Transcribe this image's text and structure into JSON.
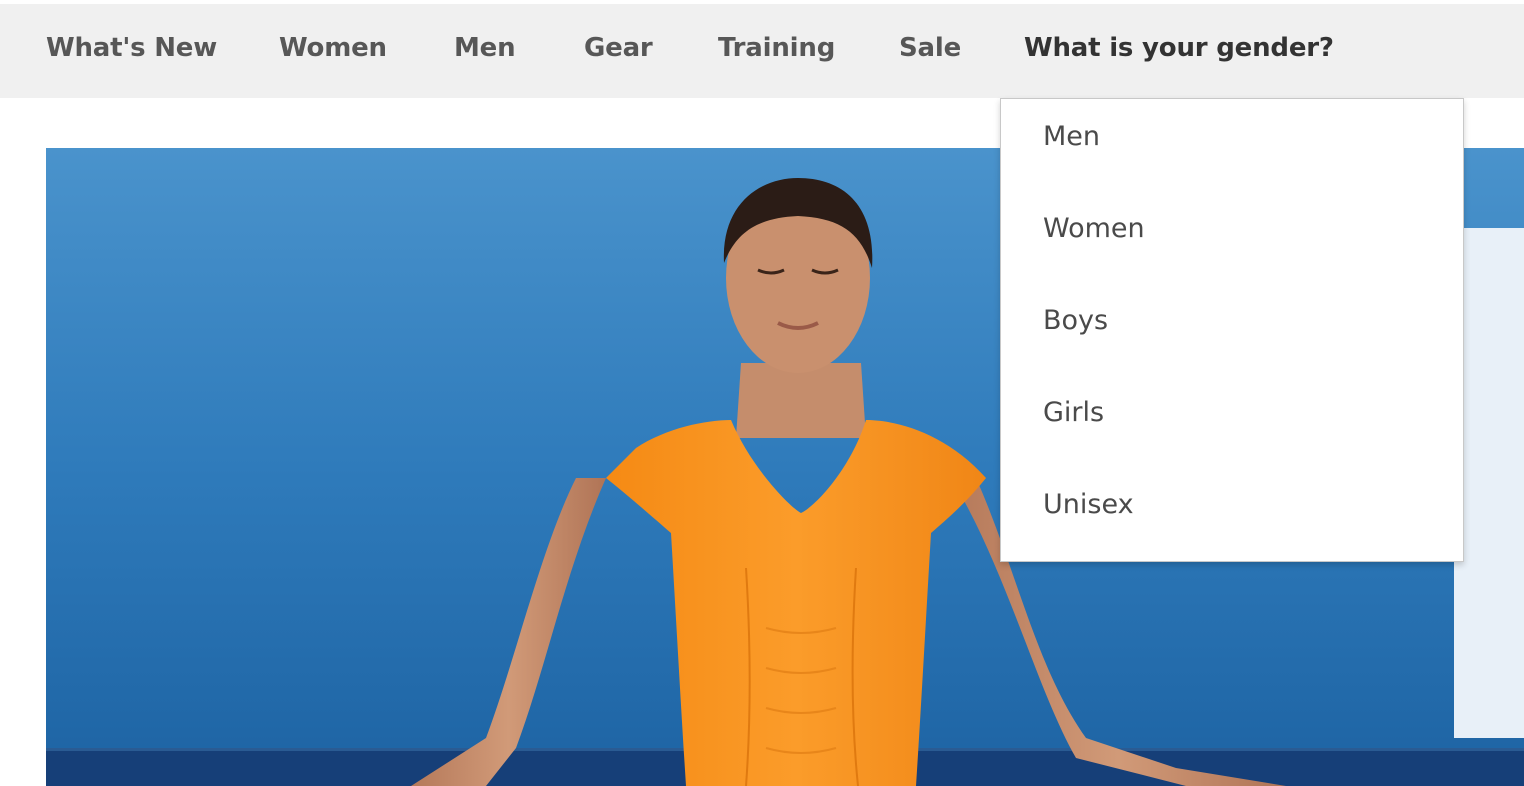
{
  "nav": {
    "items": [
      {
        "label": "What's New"
      },
      {
        "label": "Women"
      },
      {
        "label": "Men"
      },
      {
        "label": "Gear"
      },
      {
        "label": "Training"
      },
      {
        "label": "Sale"
      },
      {
        "label": "What is your gender?"
      }
    ]
  },
  "gender_dropdown": {
    "options": [
      {
        "label": "Men"
      },
      {
        "label": "Women"
      },
      {
        "label": "Boys"
      },
      {
        "label": "Girls"
      },
      {
        "label": "Unisex"
      }
    ]
  },
  "colors": {
    "nav_background": "#f0f0f0",
    "nav_text": "#575757",
    "sky": "#2d79b9",
    "shirt": "#f7931e"
  }
}
